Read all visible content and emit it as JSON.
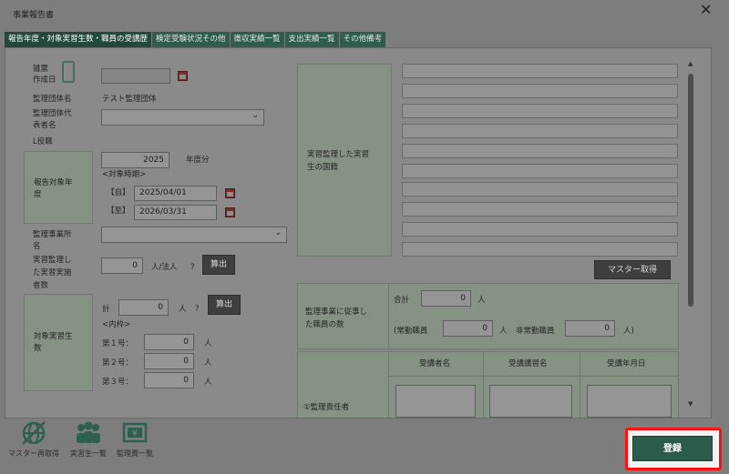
{
  "window": {
    "title": "事業報告書",
    "close": "✕"
  },
  "tabs": [
    {
      "label": "報告年度・対象実習生数・職員の受講歴",
      "active": true
    },
    {
      "label": "検定受験状況その他"
    },
    {
      "label": "徴収実績一覧"
    },
    {
      "label": "支出実績一覧"
    },
    {
      "label": "その他備考"
    }
  ],
  "left": {
    "doc_date_label": "雑票\n作成日",
    "org_name_label": "監理団体名",
    "org_name_value": "テスト監理団体",
    "rep_label": "監理団体代\n表者名",
    "role_label": "L役職",
    "report_year_label": "報告対象年\n度",
    "year_value": "2025",
    "year_suffix": "年度分",
    "period_label": "<対象時期>",
    "from_label": "【自】",
    "from_value": "2025/04/01",
    "to_label": "【至】",
    "to_value": "2026/03/31",
    "office_label": "監理事業所\n名",
    "impl_label": "実習監理し\nた実習実施\n者数",
    "impl_value": "0",
    "impl_unit": "人/法人",
    "question": "?",
    "calc_label": "算出",
    "trainees_label": "対象実習生\n数",
    "total_label": "計",
    "total_value": "0",
    "person_unit": "人",
    "breakdown_label": "<内枠>",
    "no1_label": "第１号：",
    "no1_value": "0",
    "no2_label": "第２号：",
    "no2_value": "0",
    "no3_label": "第３号：",
    "no3_value": "0"
  },
  "right": {
    "nationality_label": "実習監理した実習\n生の国籍",
    "master_btn": "マスター取得",
    "staff_label": "監理事業に従事し\nた職員の数",
    "sum_label": "合計",
    "sum_value": "0",
    "fulltime_label": "(常勤職員",
    "fulltime_value": "0",
    "parttime_label": "非常勤職員",
    "parttime_value": "0",
    "close_paren": "人)",
    "person_unit": "人",
    "col_student": "受講者名",
    "col_course": "受講講習名",
    "col_date": "受講年月日",
    "row1_label": "①監理責任者"
  },
  "bottom": {
    "icons": [
      {
        "label": "マスター再取得",
        "icon": "globe-icon"
      },
      {
        "label": "実習生一覧",
        "icon": "people-icon"
      },
      {
        "label": "監理費一覧",
        "icon": "yen-icon"
      }
    ],
    "register": "登録"
  },
  "colors": {
    "tab": "#2e5d4e",
    "highlight": "#ff1010",
    "register_btn": "#2b5b4b"
  }
}
